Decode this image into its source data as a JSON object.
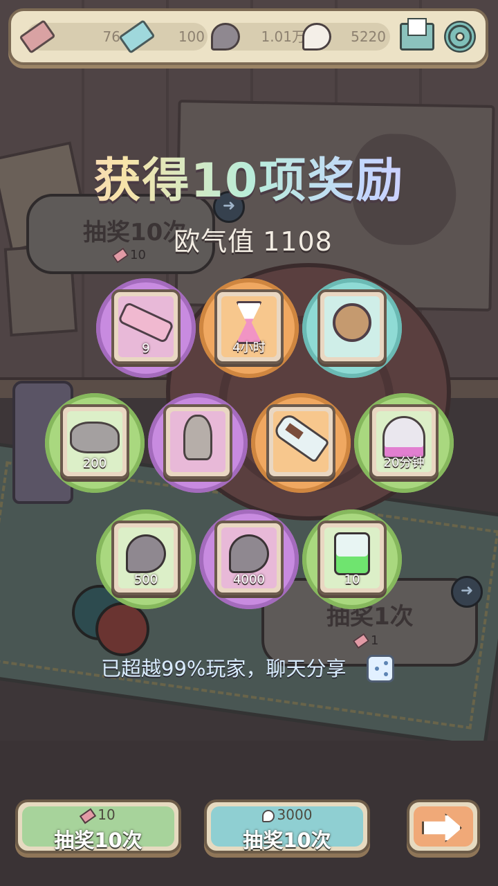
{
  "topbar": {
    "resources": [
      {
        "icon": "red-ticket-icon",
        "value": "76"
      },
      {
        "icon": "blue-ticket-icon",
        "value": "100"
      },
      {
        "icon": "dark-soul-icon",
        "value": "1.01万"
      },
      {
        "icon": "white-soul-icon",
        "value": "5220"
      }
    ],
    "mail_icon": "mail-icon",
    "settings_icon": "gear-icon"
  },
  "background": {
    "draw_ten_bubble": {
      "label": "抽奖10次",
      "cost": "10"
    },
    "draw_one_bubble": {
      "label": "抽奖1次",
      "cost": "1"
    }
  },
  "result": {
    "title": "获得10项奖励",
    "luck_label": "欧气值",
    "luck_value": "1108",
    "rewards": [
      {
        "item": "telescope",
        "quantity": "9",
        "rarity": "purple"
      },
      {
        "item": "hourglass",
        "quantity": "4小时",
        "rarity": "orange"
      },
      {
        "item": "spinning-wheel",
        "quantity": "",
        "rarity": "teal"
      },
      {
        "item": "stones",
        "quantity": "200",
        "rarity": "green"
      },
      {
        "item": "mermaid-statue",
        "quantity": "",
        "rarity": "purple"
      },
      {
        "item": "ship-in-bottle",
        "quantity": "",
        "rarity": "orange"
      },
      {
        "item": "ghost",
        "quantity": "20分钟",
        "rarity": "green"
      },
      {
        "item": "dark-soul",
        "quantity": "500",
        "rarity": "green"
      },
      {
        "item": "dark-soul",
        "quantity": "4000",
        "rarity": "purple"
      },
      {
        "item": "potion-bottle",
        "quantity": "10",
        "rarity": "green"
      }
    ],
    "beat_text": "已超越99%玩家，聊天分享"
  },
  "buttons": {
    "draw_ten_ticket": {
      "cost": "10",
      "label": "抽奖10次"
    },
    "draw_ten_soul": {
      "cost": "3000",
      "label": "抽奖10次"
    },
    "next": {
      "icon": "arrow-right-icon"
    }
  },
  "colors": {
    "purple": "#c88be0",
    "orange": "#f0a861",
    "teal": "#8fdbd5",
    "green": "#a9d87f"
  }
}
